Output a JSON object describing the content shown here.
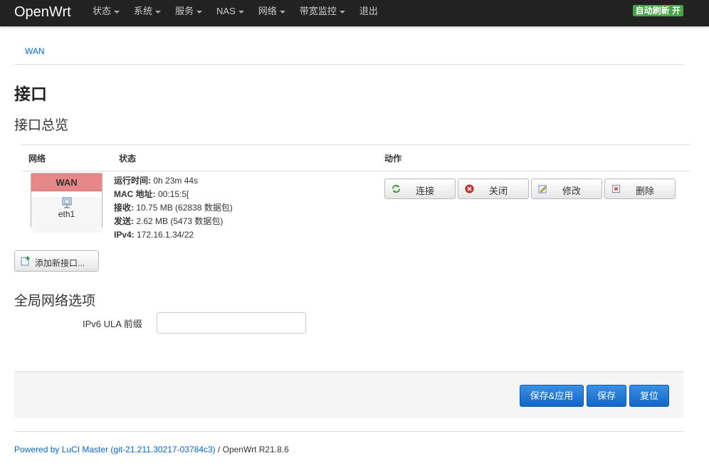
{
  "navbar": {
    "brand": "OpenWrt",
    "menu": [
      {
        "label": "状态",
        "dropdown": true
      },
      {
        "label": "系统",
        "dropdown": true
      },
      {
        "label": "服务",
        "dropdown": true
      },
      {
        "label": "NAS",
        "dropdown": true
      },
      {
        "label": "网络",
        "dropdown": true
      },
      {
        "label": "带宽监控",
        "dropdown": true
      },
      {
        "label": "退出",
        "dropdown": false
      }
    ],
    "autorefresh": "自动刷新 开"
  },
  "breadcrumb": "WAN",
  "page_title": "接口",
  "overview": {
    "title": "接口总览",
    "columns": {
      "network": "网络",
      "status": "状态",
      "actions": "动作"
    },
    "interface": {
      "name": "WAN",
      "device": "eth1",
      "status": {
        "uptime_label": "运行时间:",
        "uptime_value": " 0h 23m 44s",
        "mac_label": "MAC 地址:",
        "mac_value": " 00:15:5[",
        "rx_label": "接收:",
        "rx_value": " 10.75 MB (62838 数据包)",
        "tx_label": "发送:",
        "tx_value": " 2.62 MB (5473 数据包)",
        "ipv4_label": "IPv4:",
        "ipv4_value": " 172.16.1.34/22"
      }
    },
    "buttons": {
      "connect": "连接",
      "stop": "关闭",
      "edit": "修改",
      "delete": "删除"
    },
    "add_interface": "添加新接口..."
  },
  "global": {
    "title": "全局网络选项",
    "ula_label": "IPv6 ULA 前缀",
    "ula_value": ""
  },
  "form_actions": {
    "save_apply": "保存&应用",
    "save": "保存",
    "reset": "复位"
  },
  "footer": {
    "link_text": "Powered by LuCI Master (git-21.211.30217-03784c3)",
    "suffix": " / OpenWrt R21.8.6"
  },
  "colors": {
    "navbar_bg": "#222222",
    "wan_header": "#e88787",
    "autorefresh_bg": "#46a546",
    "primary_button": "#1f77d0",
    "link": "#0069d6"
  }
}
